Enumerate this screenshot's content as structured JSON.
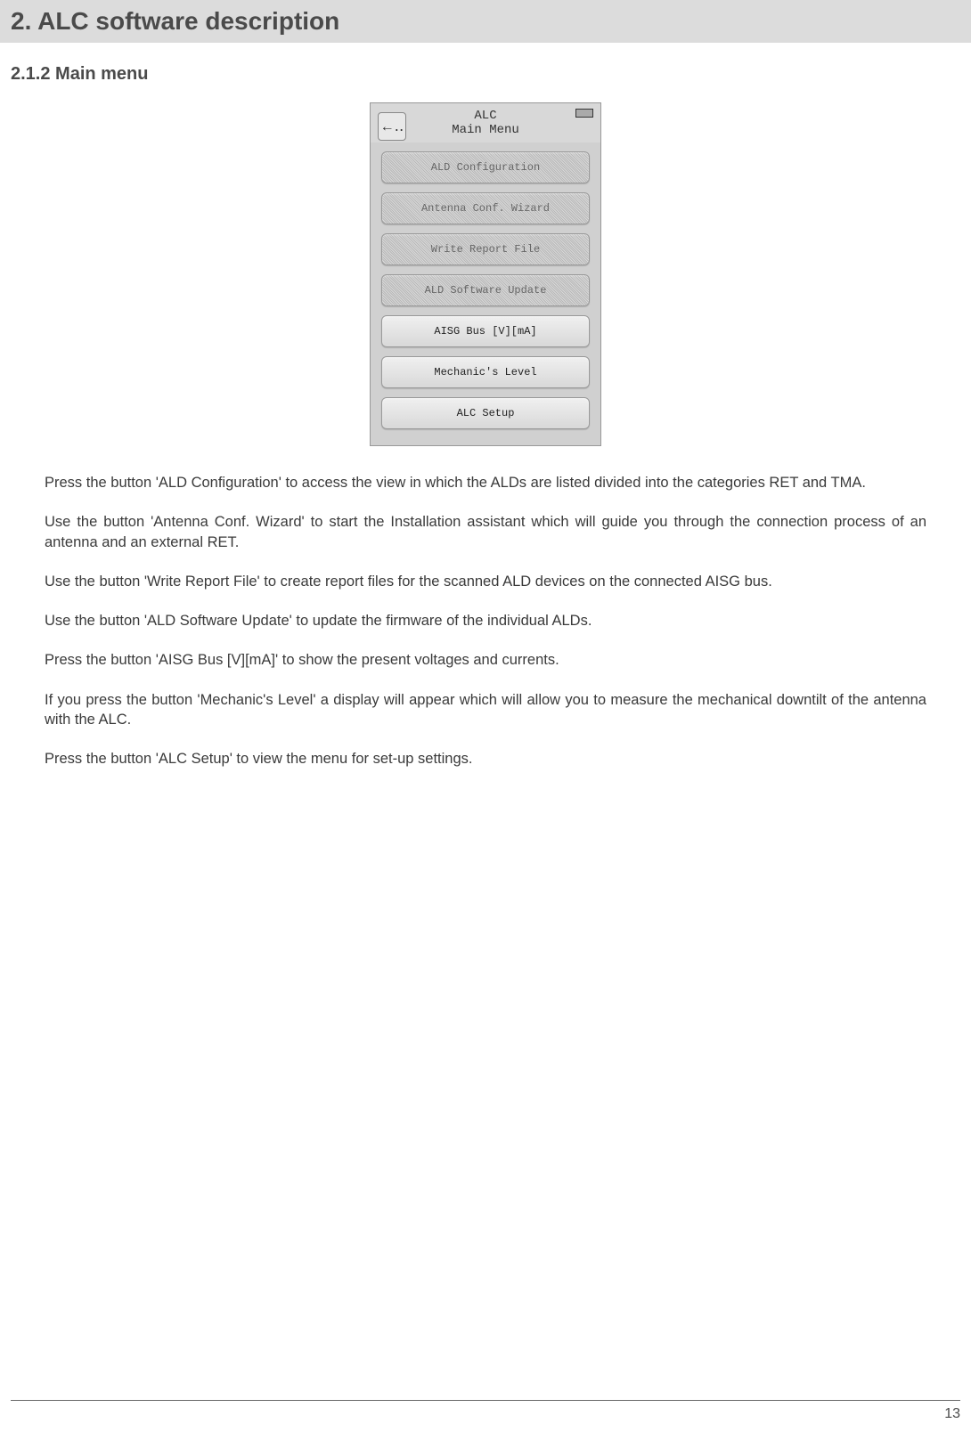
{
  "header": {
    "title": "2. ALC software description"
  },
  "subsection": {
    "title": "2.1.2 Main menu"
  },
  "device": {
    "back_symbol": "←‥",
    "title_line1": "ALC",
    "title_line2": "Main Menu",
    "menu_items": [
      {
        "label": "ALD Configuration",
        "style": "dithered"
      },
      {
        "label": "Antenna Conf. Wizard",
        "style": "dithered"
      },
      {
        "label": "Write Report File",
        "style": "dithered"
      },
      {
        "label": "ALD Software Update",
        "style": "dithered"
      },
      {
        "label": "AISG Bus [V][mA]",
        "style": "plain"
      },
      {
        "label": "Mechanic's Level",
        "style": "plain"
      },
      {
        "label": "ALC Setup",
        "style": "plain"
      }
    ]
  },
  "body": {
    "paragraphs": [
      "Press the button 'ALD Configuration' to access the view in which the ALDs are listed divided into the categories RET and TMA.",
      "Use the button 'Antenna Conf. Wizard' to start the Installation assistant which will guide you through the connection process of an antenna and an external RET.",
      "Use the button 'Write Report File' to create report files for the scanned ALD devices on the connected AISG bus.",
      "Use the button 'ALD Software Update' to update the firmware of the individual ALDs.",
      "Press the button 'AISG Bus [V][mA]' to show the present voltages and currents.",
      "If you press the button 'Mechanic's Level' a display will appear which will allow you to measure the mechanical downtilt of the antenna with the ALC.",
      "Press the button 'ALC Setup' to view the menu for set-up settings."
    ]
  },
  "footer": {
    "page_number": "13"
  }
}
